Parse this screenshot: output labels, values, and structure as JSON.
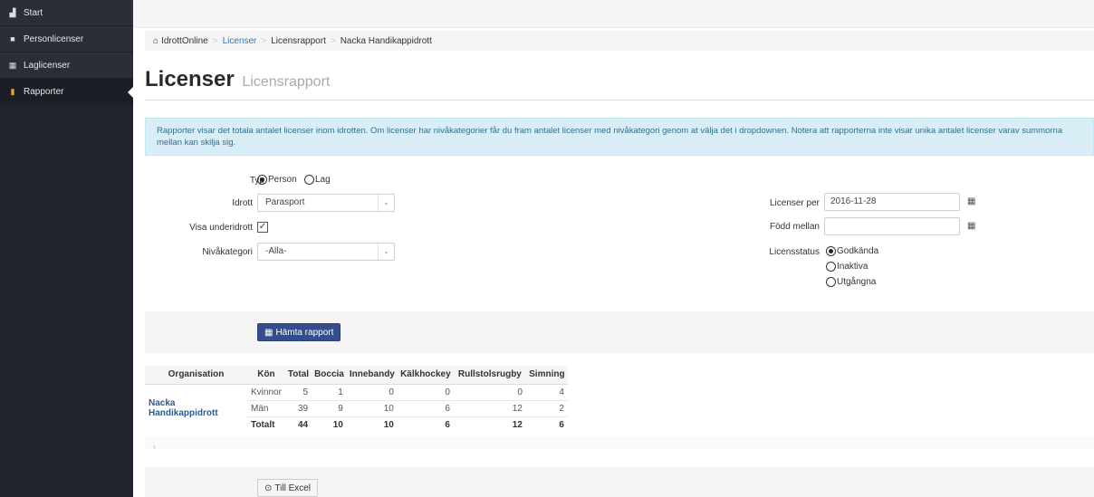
{
  "sidebar": {
    "items": [
      {
        "label": "Start",
        "icon": "home-icon",
        "glyph": "▟"
      },
      {
        "label": "Personlicenser",
        "icon": "user-icon",
        "glyph": "■"
      },
      {
        "label": "Laglicenser",
        "icon": "users-icon",
        "glyph": "▦"
      },
      {
        "label": "Rapporter",
        "icon": "chart-icon",
        "glyph": "▮",
        "active": true
      }
    ]
  },
  "breadcrumb": {
    "home_glyph": "⌂",
    "items": [
      "IdrottOnline",
      "Licenser",
      "Licensrapport",
      "Nacka Handikappidrott"
    ]
  },
  "page": {
    "title": "Licenser",
    "subtitle": "Licensrapport"
  },
  "info_text": "Rapporter visar det totala antalet licenser inom idrotten. Om licenser har nivåkategorier får du fram antalet licenser med nivåkategori genom at välja det i dropdownen. Notera att rapporterna inte visar unika antalet licenser varav summorna mellan kan skilja sig.",
  "form": {
    "typ_label": "Typ",
    "typ_options": [
      "Person",
      "Lag"
    ],
    "idrott_label": "Idrott",
    "idrott_value": "Parasport",
    "underidrott_label": "Visa underidrott",
    "underidrott_check": "✓",
    "nivakategori_label": "Nivåkategori",
    "nivakategori_value": "-Alla-",
    "licenser_per_label": "Licenser per",
    "licenser_per_value": "2016-11-28",
    "fodd_mellan_label": "Född mellan",
    "fodd_mellan_value": "",
    "licensstatus_label": "Licensstatus",
    "licensstatus_options": [
      "Godkända",
      "Inaktiva",
      "Utgångna"
    ]
  },
  "buttons": {
    "hamta": "Hämta rapport",
    "hamta_icon": "▦",
    "excel": "Till Excel",
    "excel_icon": "⊙"
  },
  "table": {
    "headers": [
      "Organisation",
      "Kön",
      "Total",
      "Boccia",
      "Innebandy",
      "Kälkhockey",
      "Rullstolsrugby",
      "Simning"
    ],
    "organisation": "Nacka Handikappidrott",
    "rows": [
      [
        "Kvinnor",
        "5",
        "1",
        "0",
        "0",
        "0",
        "4"
      ],
      [
        "Män",
        "39",
        "9",
        "10",
        "6",
        "12",
        "2"
      ],
      [
        "Totalt",
        "44",
        "10",
        "10",
        "6",
        "12",
        "6"
      ]
    ]
  },
  "scroll_glyph": "‹",
  "calendar_glyph": "▦",
  "caret_glyph": "⌄"
}
